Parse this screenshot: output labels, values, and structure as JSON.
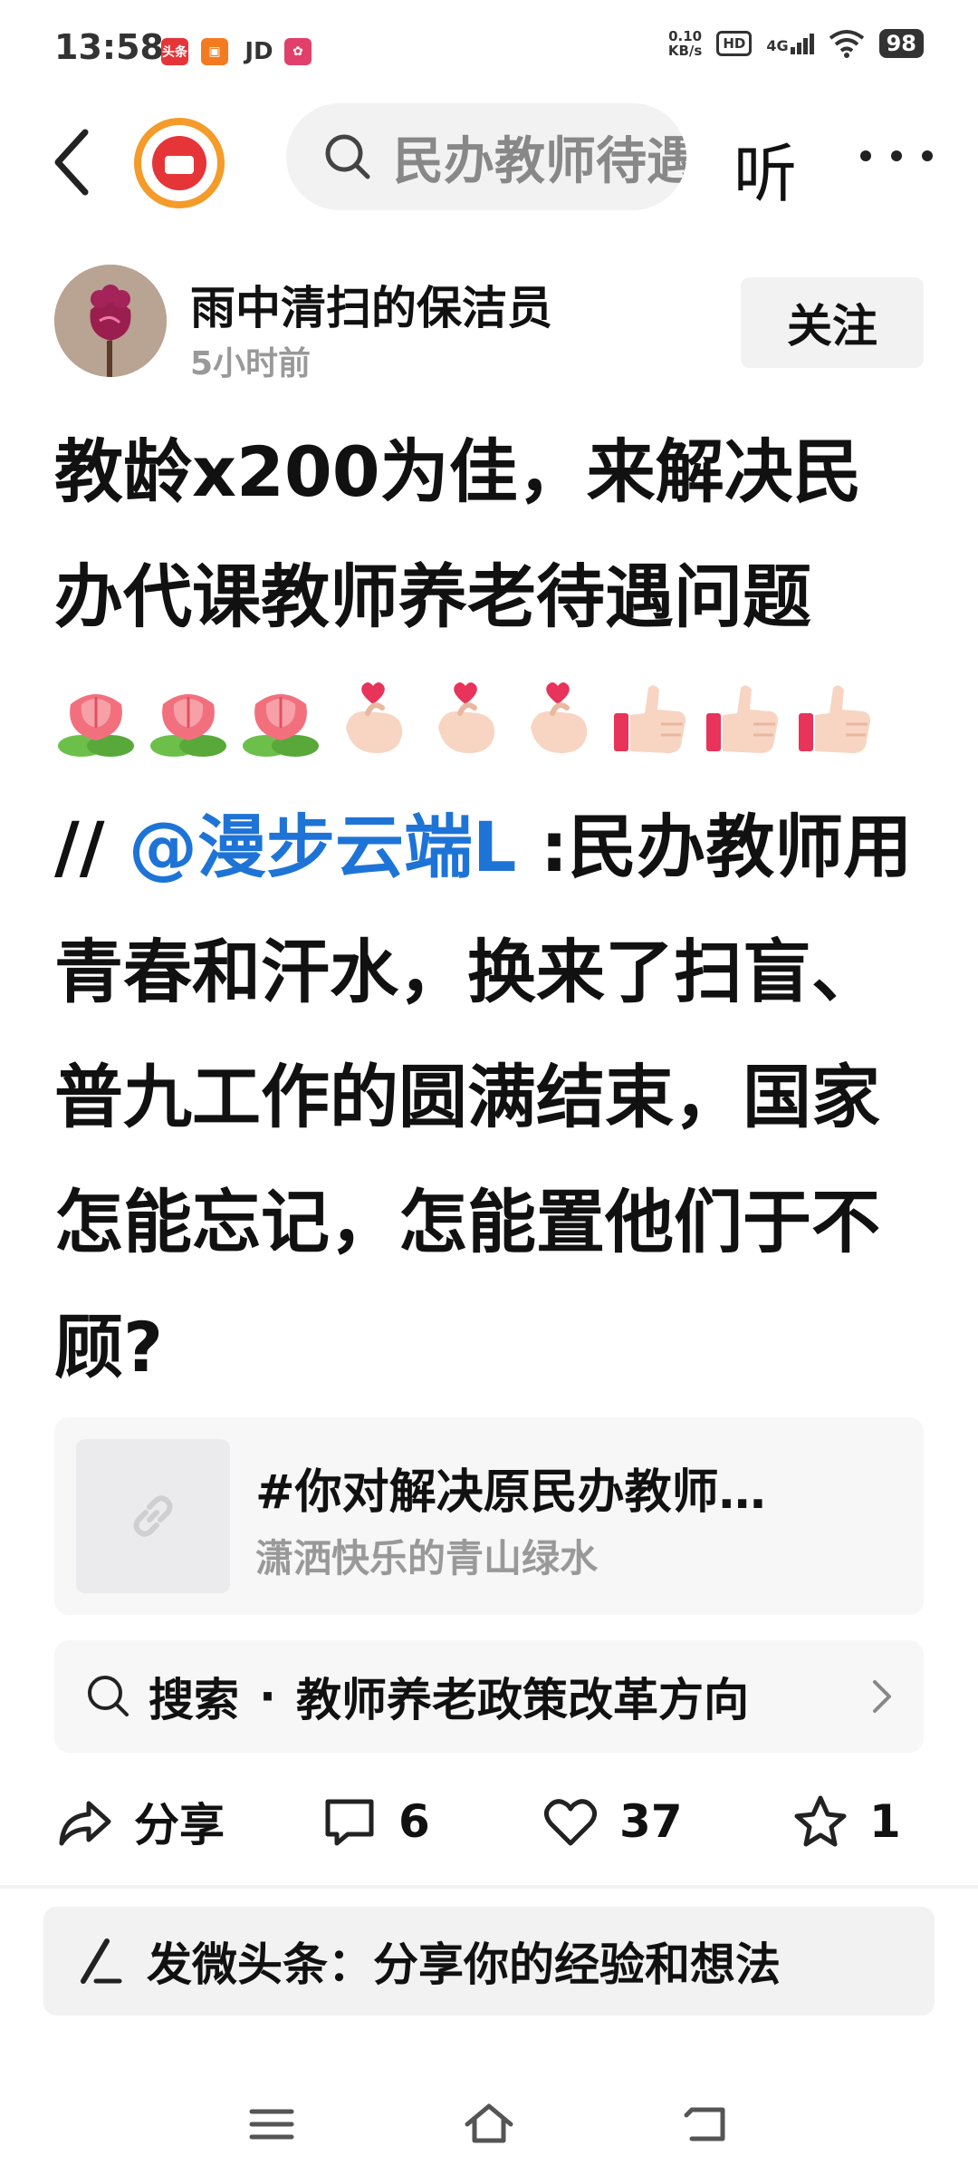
{
  "status_bar": {
    "time": "13:58",
    "notif_apps": [
      "头条",
      "JD"
    ],
    "net_speed_value": "0.10",
    "net_speed_unit": "KB/s",
    "hd_label": "HD",
    "network": "4G",
    "battery": "98"
  },
  "top_nav": {
    "search_text": "民办教师待遇",
    "listen_label": "听"
  },
  "author": {
    "name": "雨中清扫的保洁员",
    "time": "5小时前",
    "follow_label": "关注"
  },
  "post": {
    "text_part1": "教龄x200为佳，来解决民办代课教师养老待遇问题",
    "emojis_line": [
      "rose-emoji",
      "rose-emoji",
      "rose-emoji",
      "heart-hand-emoji",
      "heart-hand-emoji",
      "heart-hand-emoji",
      "thumbs-up-emoji",
      "thumbs-up-emoji",
      "thumbs-up-emoji"
    ],
    "separator": "//",
    "mention": "@漫步云端L",
    "text_part2": ":民办教师用青春和汗水，换来了扫盲、普九工作的圆满结束，国家怎能忘记，怎能置他们于不顾?"
  },
  "link_card": {
    "title": "#你对解决原民办教师…",
    "subtitle": "潇洒快乐的青山绿水"
  },
  "search_suggestion": {
    "label": "搜索",
    "dot": "·",
    "query": "教师养老政策改革方向"
  },
  "actions": {
    "share_label": "分享",
    "comment_count": "6",
    "like_count": "37",
    "favorite_count": "1"
  },
  "compose": {
    "placeholder": "发微头条：分享你的经验和想法"
  },
  "colors": {
    "accent_blue": "#1e74d6",
    "logo_orange": "#f49b2a",
    "logo_red": "#e53538"
  }
}
